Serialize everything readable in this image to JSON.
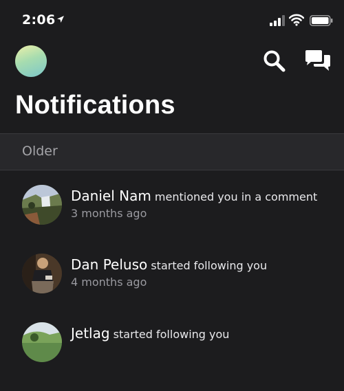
{
  "status_bar": {
    "time": "2:06"
  },
  "header": {
    "title": "Notifications"
  },
  "section": {
    "label": "Older"
  },
  "notifications": [
    {
      "name": "Daniel Nam",
      "action": "mentioned you in a comment",
      "time": "3 months ago"
    },
    {
      "name": "Dan Peluso",
      "action": "started following you",
      "time": "4 months ago"
    },
    {
      "name": "Jetlag",
      "action": "started following you",
      "time": ""
    }
  ],
  "colors": {
    "background": "#1c1c1e",
    "section_bg": "#28282b",
    "secondary_text": "#9a9aa0"
  },
  "icons": [
    "location-arrow-icon",
    "signal-icon",
    "wifi-icon",
    "battery-icon",
    "search-icon",
    "chat-bubbles-icon"
  ]
}
